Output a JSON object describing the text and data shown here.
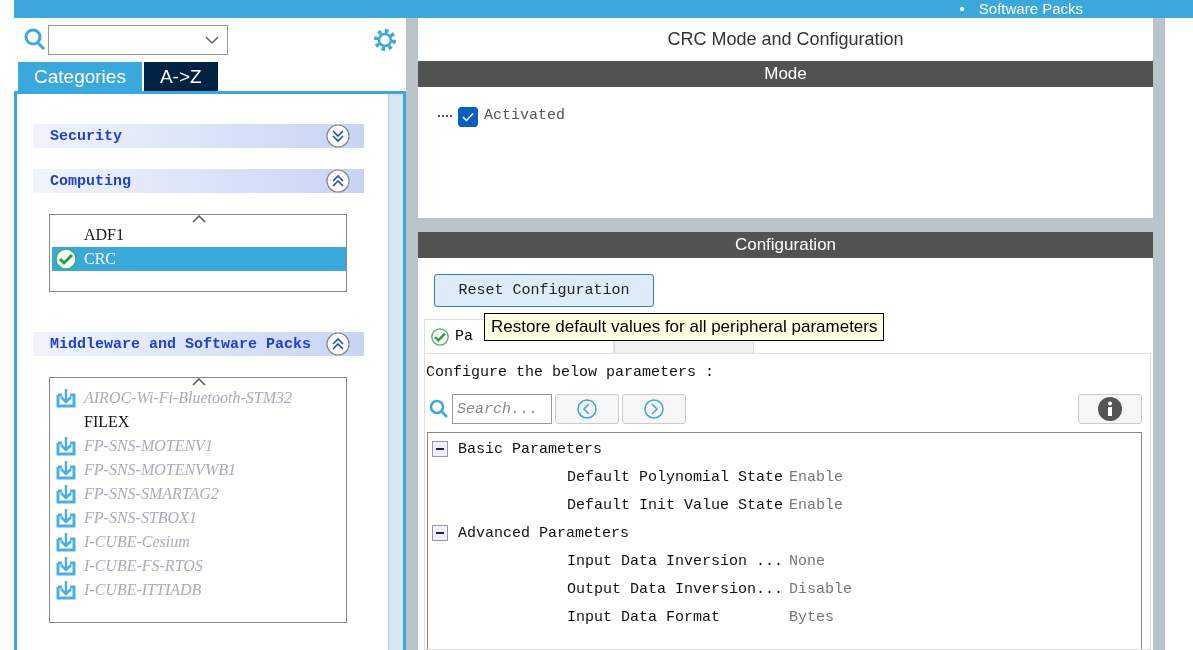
{
  "top_bar": {
    "bullet": "•",
    "text": "Software Packs"
  },
  "sidebar": {
    "tabs": [
      {
        "label": "Categories",
        "selected": true
      },
      {
        "label": "A->Z",
        "selected": false
      }
    ],
    "sections": [
      {
        "title": "Security",
        "expanded": false
      },
      {
        "title": "Computing",
        "expanded": true,
        "items": [
          {
            "label": "ADF1",
            "kind": "plain",
            "selected": false
          },
          {
            "label": "CRC",
            "kind": "enabled",
            "selected": true
          }
        ]
      },
      {
        "title": "Middleware and Software Packs",
        "expanded": true,
        "items": [
          {
            "label": "AIROC-Wi-Fi-Bluetooth-STM32",
            "kind": "download",
            "selected": false
          },
          {
            "label": "FILEX",
            "kind": "plain",
            "selected": false
          },
          {
            "label": "FP-SNS-MOTENV1",
            "kind": "download",
            "selected": false
          },
          {
            "label": "FP-SNS-MOTENVWB1",
            "kind": "download",
            "selected": false
          },
          {
            "label": "FP-SNS-SMARTAG2",
            "kind": "download",
            "selected": false
          },
          {
            "label": "FP-SNS-STBOX1",
            "kind": "download",
            "selected": false
          },
          {
            "label": "I-CUBE-Cesium",
            "kind": "download",
            "selected": false
          },
          {
            "label": "I-CUBE-FS-RTOS",
            "kind": "download",
            "selected": false
          },
          {
            "label": "I-CUBE-ITTIADB",
            "kind": "download",
            "selected": false
          }
        ]
      }
    ]
  },
  "main": {
    "title": "CRC Mode and Configuration",
    "mode": {
      "header": "Mode",
      "checkbox": {
        "label": "Activated",
        "checked": true
      }
    },
    "configuration": {
      "header": "Configuration",
      "reset_button": "Reset Configuration",
      "tooltip": "Restore default values for all peripheral parameters",
      "tabs": [
        {
          "label": "Pa",
          "selected": true
        },
        {
          "selected": false
        }
      ],
      "intro": "Configure the below parameters :",
      "search": {
        "placeholder": "Search..."
      },
      "groups": [
        {
          "title": "Basic Parameters",
          "expanded": true,
          "params": [
            {
              "name": "Default Polynomial State",
              "value": "Enable"
            },
            {
              "name": "Default Init Value State",
              "value": "Enable"
            }
          ]
        },
        {
          "title": "Advanced Parameters",
          "expanded": true,
          "params": [
            {
              "name": "Input Data Inversion ...",
              "value": "None"
            },
            {
              "name": "Output Data Inversion...",
              "value": "Disable"
            },
            {
              "name": "Input Data Format",
              "value": "Bytes"
            }
          ]
        }
      ]
    }
  }
}
